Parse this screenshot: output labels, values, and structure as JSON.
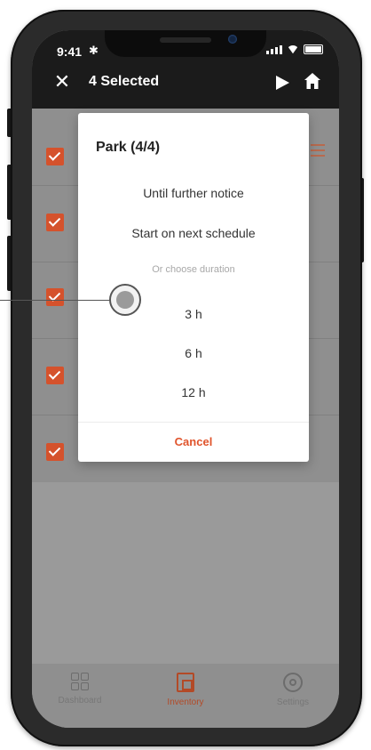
{
  "status_bar": {
    "time": "9:41",
    "bluetooth": "✱"
  },
  "app_bar": {
    "title": "4 Selected",
    "close_label": "✕"
  },
  "list": {
    "rows": [
      {
        "label": ""
      },
      {
        "label": ""
      },
      {
        "label": ""
      },
      {
        "label": ""
      },
      {
        "label": ""
      }
    ]
  },
  "dialog": {
    "title": "Park (4/4)",
    "option_until_notice": "Until further notice",
    "option_next_schedule": "Start on next schedule",
    "duration_subtitle": "Or choose duration",
    "durations": [
      "3 h",
      "6 h",
      "12 h"
    ],
    "cancel_label": "Cancel"
  },
  "tabbar": {
    "tabs": [
      {
        "label": "Dashboard"
      },
      {
        "label": "Inventory"
      },
      {
        "label": "Settings"
      }
    ]
  },
  "colors": {
    "accent": "#e0542c",
    "appbar": "#1b1b1b",
    "overlay": "#9a9a9a"
  }
}
